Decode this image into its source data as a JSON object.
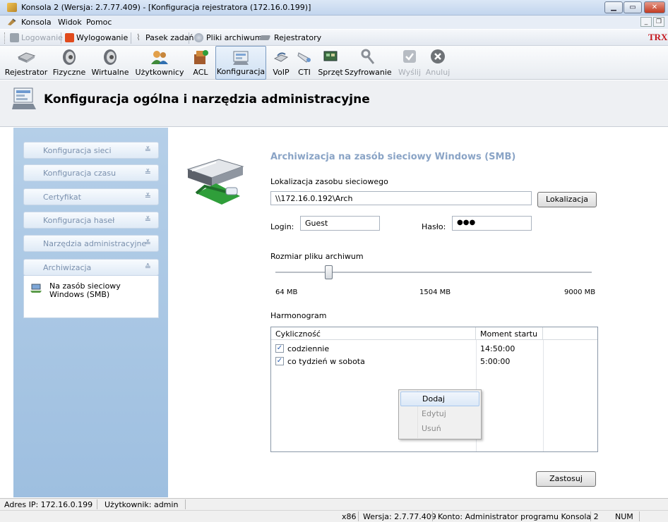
{
  "window": {
    "title": "Konsola 2 (Wersja: 2.7.77.409) - [Konfiguracja rejestratora (172.16.0.199)]"
  },
  "menu": [
    "Konsola",
    "Widok",
    "Pomoc"
  ],
  "quickbar": {
    "logowanie": "Logowanie",
    "wylogowanie": "Wylogowanie",
    "pasek": "Pasek zadań",
    "pliki": "Pliki archiwum",
    "rejestratory": "Rejestratory",
    "brand": "TRX"
  },
  "toolbar": [
    "Rejestrator",
    "Fizyczne",
    "Wirtualne",
    "Użytkownicy",
    "ACL",
    "Konfiguracja",
    "VoIP",
    "CTI",
    "Sprzęt",
    "Szyfrowanie",
    "Wyślij",
    "Anuluj"
  ],
  "header": {
    "title": "Konfiguracja ogólna i narzędzia administracyjne"
  },
  "sidebar": {
    "sections": [
      "Konfiguracja sieci",
      "Konfiguracja czasu",
      "Certyfikat",
      "Konfiguracja haseł",
      "Narzędzia administracyjne",
      "Archiwizacja"
    ],
    "item_label": "Na zasób sieciowy Windows (SMB)"
  },
  "main": {
    "title": "Archiwizacja na zasób sieciowy Windows (SMB)",
    "location_label": "Lokalizacja zasobu sieciowego",
    "location_value": "\\\\172.16.0.192\\Arch",
    "location_button": "Lokalizacja",
    "login_label": "Login:",
    "login_value": "Guest",
    "password_label": "Hasło:",
    "password_value": "●●●",
    "size_label": "Rozmiar pliku archiwum",
    "size_min": "64 MB",
    "size_current": "1504 MB",
    "size_max": "9000 MB",
    "slider_fraction": 0.168,
    "schedule_label": "Harmonogram",
    "grid": {
      "col_freq": "Cykliczność",
      "col_start": "Moment startu",
      "rows": [
        {
          "freq": "codziennie",
          "start": "14:50:00",
          "checked": true
        },
        {
          "freq": "co tydzień w sobota",
          "start": "5:00:00",
          "checked": true
        }
      ]
    },
    "context_menu": [
      "Dodaj",
      "Edytuj",
      "Usuń"
    ],
    "apply_button": "Zastosuj"
  },
  "status": {
    "ip": "Adres IP: 172.16.0.199",
    "user": "Użytkownik: admin",
    "arch": "x86",
    "version": "Wersja: 2.7.77.409",
    "account": "Konto: Administrator programu Konsola 2",
    "num": "NUM"
  }
}
